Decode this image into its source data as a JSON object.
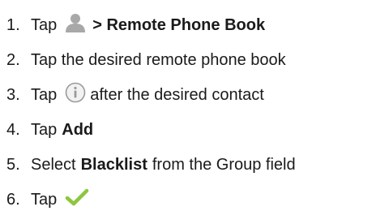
{
  "steps": [
    {
      "number": "1.",
      "tap": "Tap",
      "icon": "contact-person-icon",
      "bold": "> Remote Phone Book"
    },
    {
      "number": "2.",
      "text": "Tap the desired remote phone book"
    },
    {
      "number": "3.",
      "tap": "Tap",
      "icon": "info-icon",
      "after": "after the desired contact"
    },
    {
      "number": "4.",
      "tap": "Tap",
      "bold": "Add"
    },
    {
      "number": "5.",
      "before": "Select",
      "bold": "Blacklist",
      "after": "from the Group field"
    },
    {
      "number": "6.",
      "tap": "Tap",
      "icon": "checkmark-icon"
    }
  ],
  "colors": {
    "text": "#1a1a1a",
    "icon_gray": "#9a9a9a",
    "check_green": "#8cc63f"
  }
}
